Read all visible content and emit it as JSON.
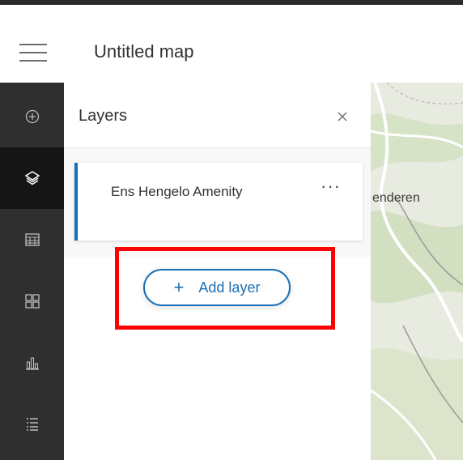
{
  "header": {
    "menu_icon": "hamburger-icon",
    "title": "Untitled map"
  },
  "left_rail": {
    "items": [
      {
        "icon": "add-circle-icon"
      },
      {
        "icon": "layers-icon",
        "active": true
      },
      {
        "icon": "table-icon"
      },
      {
        "icon": "grid-icon"
      },
      {
        "icon": "chart-icon"
      },
      {
        "icon": "list-icon"
      }
    ]
  },
  "panel": {
    "title": "Layers",
    "close_icon": "close-icon",
    "layer": {
      "name": "Ens Hengelo Amenity",
      "menu": "···"
    },
    "add_layer": {
      "plus": "+",
      "label": "Add layer"
    }
  },
  "map": {
    "label": "enderen"
  },
  "colors": {
    "accent": "#1a6fb5",
    "rail": "#2f2f2f",
    "highlight": "#ff0000"
  }
}
